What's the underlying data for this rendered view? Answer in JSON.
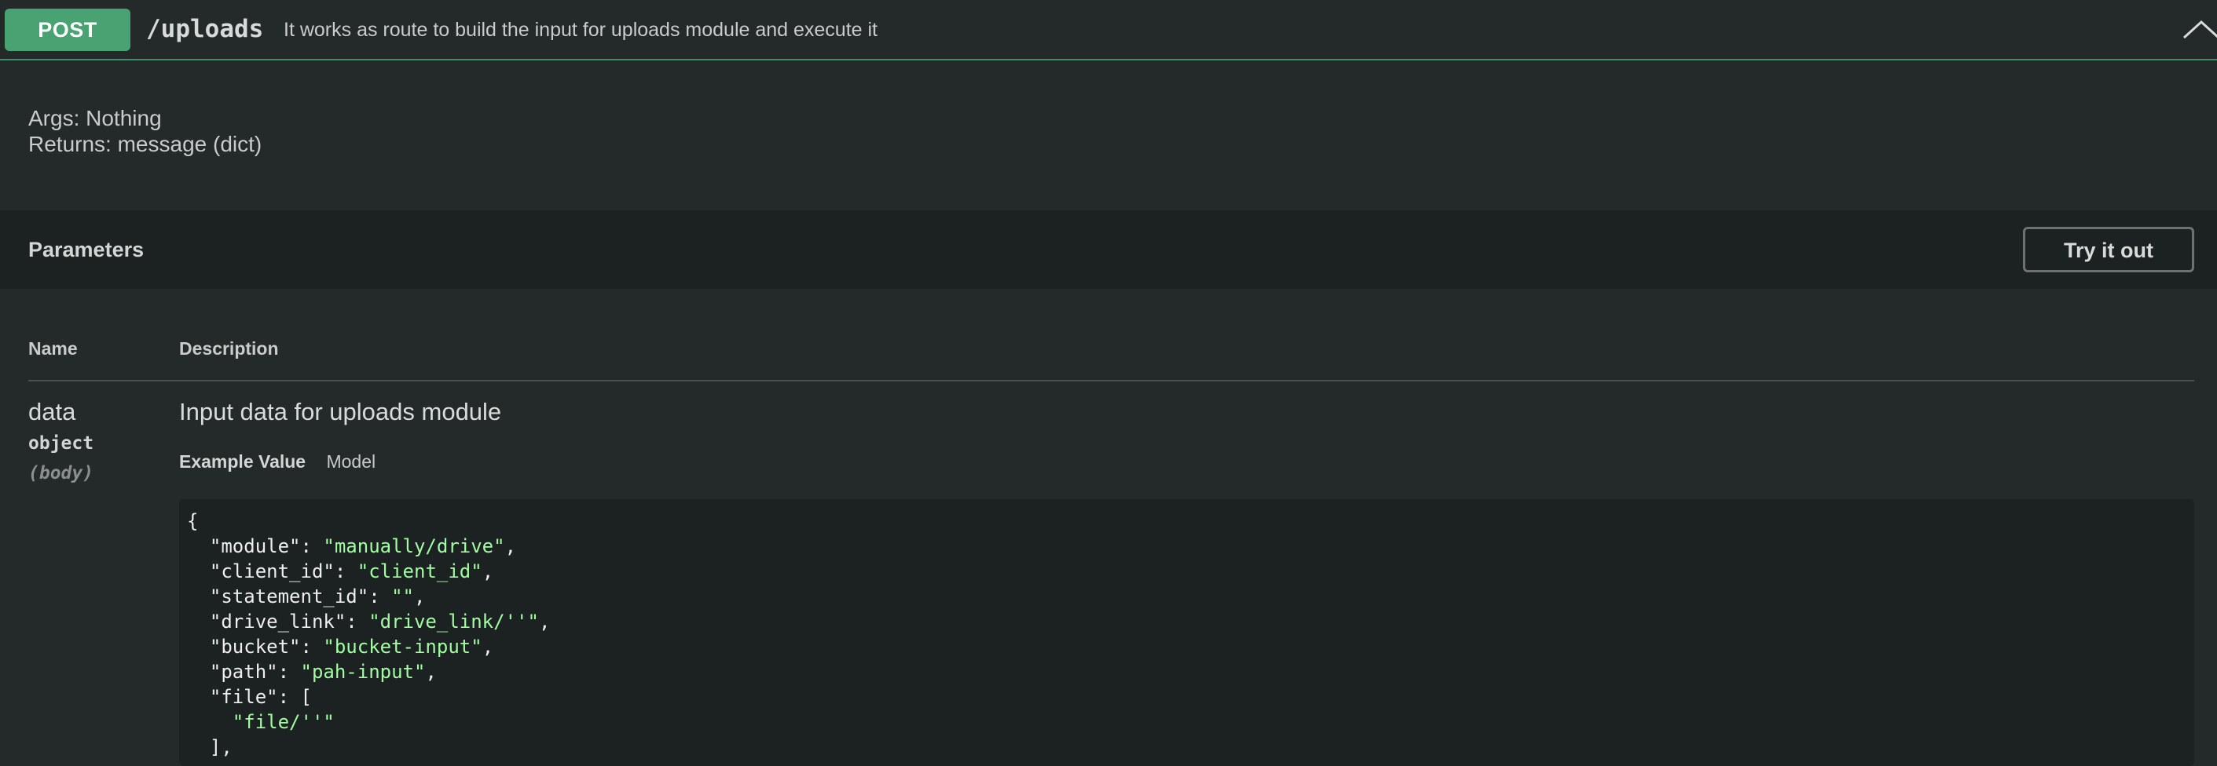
{
  "operation": {
    "method": "POST",
    "path": "/uploads",
    "summary": "It works as route to build the input for uploads module and execute it",
    "collapse_icon": "chevron-up-icon",
    "description_lines": [
      "Args: Nothing",
      "Returns: message (dict)"
    ]
  },
  "parameters": {
    "title": "Parameters",
    "try_button_label": "Try it out",
    "columns": {
      "name": "Name",
      "description": "Description"
    },
    "items": [
      {
        "name": "data",
        "type": "object",
        "in": "(body)",
        "description": "Input data for uploads module",
        "tabs": {
          "active": "Example Value",
          "inactive": "Model"
        },
        "example_lines": [
          {
            "pre": "{",
            "str": "",
            "post": ""
          },
          {
            "pre": "  \"module\": ",
            "str": "\"manually/drive\"",
            "post": ","
          },
          {
            "pre": "  \"client_id\": ",
            "str": "\"client_id\"",
            "post": ","
          },
          {
            "pre": "  \"statement_id\": ",
            "str": "\"\"",
            "post": ","
          },
          {
            "pre": "  \"drive_link\": ",
            "str": "\"drive_link/''\"",
            "post": ","
          },
          {
            "pre": "  \"bucket\": ",
            "str": "\"bucket-input\"",
            "post": ","
          },
          {
            "pre": "  \"path\": ",
            "str": "\"pah-input\"",
            "post": ","
          },
          {
            "pre": "  \"file\": [",
            "str": "",
            "post": ""
          },
          {
            "pre": "    ",
            "str": "\"file/''\"",
            "post": ""
          },
          {
            "pre": "  ],",
            "str": "",
            "post": ""
          }
        ]
      }
    ]
  },
  "colors": {
    "post_green": "#49a271",
    "background": "#232a29",
    "string_green": "#a2fca2"
  }
}
